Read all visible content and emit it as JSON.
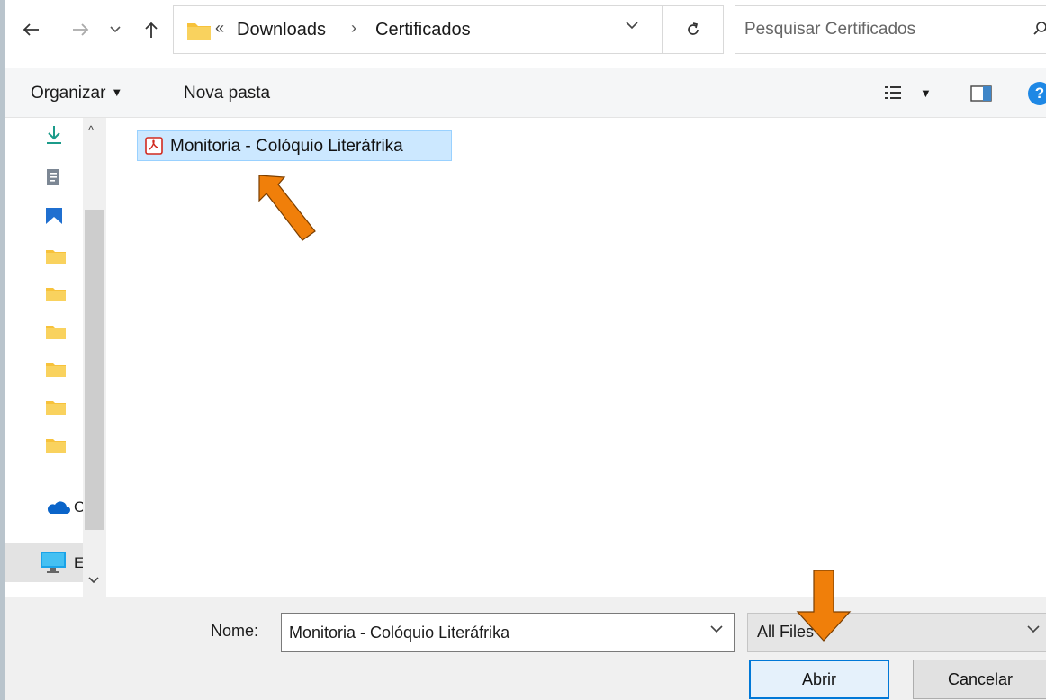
{
  "breadcrumb": {
    "overflow": "«",
    "items": [
      "Downloads",
      "Certificados"
    ],
    "separator": "›"
  },
  "search": {
    "placeholder": "Pesquisar Certificados"
  },
  "toolbar": {
    "organize": "Organizar",
    "new_folder": "Nova pasta",
    "help": "?"
  },
  "nav": {
    "onedrive_label": "O",
    "pc_label": "E"
  },
  "files": [
    {
      "name": "Monitoria - Colóquio Literáfrika",
      "type": "pdf"
    }
  ],
  "footer": {
    "name_label": "Nome:",
    "name_value": "Monitoria - Colóquio Literáfrika",
    "filter_value": "All Files",
    "open_button": "Abrir",
    "cancel_button": "Cancelar"
  },
  "colors": {
    "accent": "#0078d7",
    "selection": "#cce8ff",
    "annotation_arrow": "#f07f0a",
    "folder": "#f7c23b"
  }
}
